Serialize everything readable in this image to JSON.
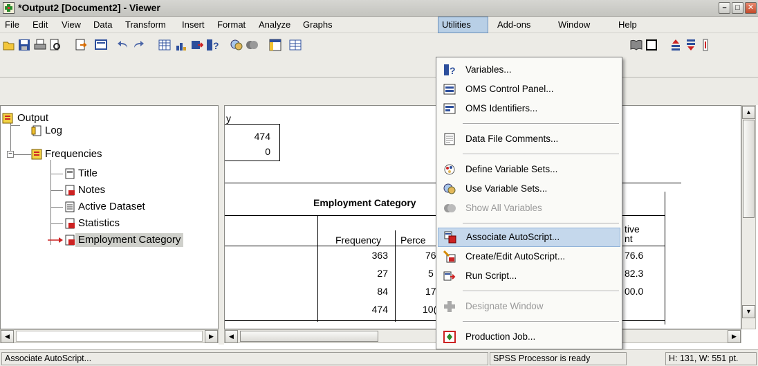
{
  "window": {
    "title": "*Output2 [Document2] - Viewer"
  },
  "menubar": {
    "items": [
      {
        "label": "File"
      },
      {
        "label": "Edit"
      },
      {
        "label": "View"
      },
      {
        "label": "Data"
      },
      {
        "label": "Transform"
      },
      {
        "label": "Insert"
      },
      {
        "label": "Format"
      },
      {
        "label": "Analyze"
      },
      {
        "label": "Graphs"
      },
      {
        "label": "Utilities"
      },
      {
        "label": "Add-ons"
      },
      {
        "label": "Window"
      },
      {
        "label": "Help"
      }
    ],
    "active": "Utilities"
  },
  "outline": {
    "root": "Output",
    "log": "Log",
    "frequencies": "Frequencies",
    "children": [
      "Title",
      "Notes",
      "Active Dataset",
      "Statistics",
      "Employment Category"
    ],
    "selected": "Employment Category"
  },
  "content": {
    "stats_fragment": "y",
    "stats_values": [
      "474",
      "0"
    ],
    "table_title": "Employment Category",
    "col_frequency": "Frequency",
    "col_percent_fragment": "Perce",
    "col_cumulative_fragment_1": "tive",
    "col_cumulative_fragment_2": "nt",
    "frequency_values": [
      "363",
      "27",
      "84",
      "474"
    ],
    "percent_fragments": [
      "76",
      "5",
      "17",
      "10("
    ],
    "cumulative_values": [
      "76.6",
      "82.3",
      "00.0"
    ]
  },
  "utilities_menu": {
    "items": [
      {
        "label": "Variables...",
        "icon": "variables-icon",
        "enabled": true
      },
      {
        "label": "OMS Control Panel...",
        "icon": "oms-control-icon",
        "enabled": true
      },
      {
        "label": "OMS Identifiers...",
        "icon": "oms-identifiers-icon",
        "enabled": true
      },
      {
        "label": "Data File Comments...",
        "icon": "comments-icon",
        "enabled": true
      },
      {
        "label": "Define Variable Sets...",
        "icon": "define-sets-icon",
        "enabled": true
      },
      {
        "label": "Use Variable Sets...",
        "icon": "use-sets-icon",
        "enabled": true
      },
      {
        "label": "Show All Variables",
        "icon": "show-all-icon",
        "enabled": false
      },
      {
        "label": "Associate AutoScript...",
        "icon": "autoscript-icon",
        "enabled": true,
        "highlighted": true
      },
      {
        "label": "Create/Edit AutoScript...",
        "icon": "edit-autoscript-icon",
        "enabled": true
      },
      {
        "label": "Run Script...",
        "icon": "run-script-icon",
        "enabled": true
      },
      {
        "label": "Designate Window",
        "icon": "designate-window-icon",
        "enabled": false
      },
      {
        "label": "Production Job...",
        "icon": "production-job-icon",
        "enabled": true
      }
    ]
  },
  "statusbar": {
    "message": "Associate AutoScript...",
    "processor": "SPSS  Processor is ready",
    "dimensions": "H: 131, W: 551 pt."
  },
  "colors": {
    "menu_highlight": "#c5d8ec",
    "chrome": "#ecebe6",
    "selection": "#cfd0cb"
  }
}
